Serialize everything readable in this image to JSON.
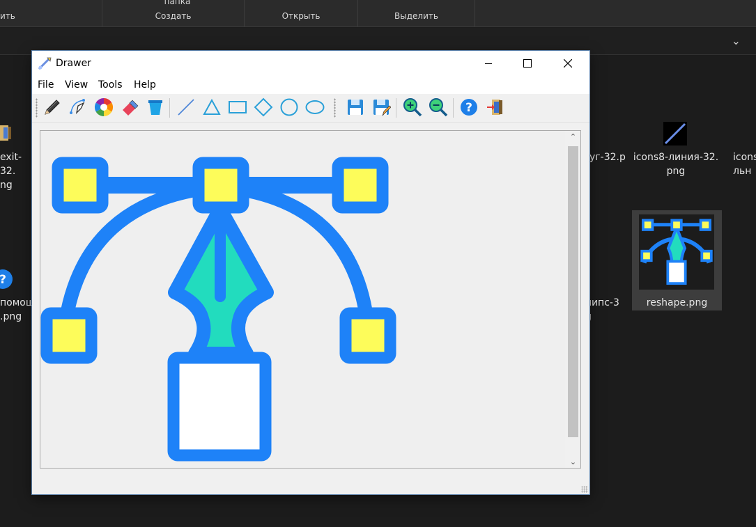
{
  "explorer": {
    "ribbon_groups": [
      {
        "label": "ить"
      },
      {
        "label": "Создать"
      },
      {
        "label": "Открыть"
      },
      {
        "label": "Выделить"
      }
    ],
    "ribbon_top_text": "папка",
    "files": [
      {
        "name_line1": "exit-32.",
        "name_line2": "ng"
      },
      {
        "name_line1": "уг-32.р",
        "name_line2": ""
      },
      {
        "name_line1": "icons8-линия-32.",
        "name_line2": "png"
      },
      {
        "name_line1": "icons",
        "name_line2": "льн"
      },
      {
        "name_line1": "помощ",
        "name_line2": ".png"
      },
      {
        "name_line1": "липс-3",
        "name_line2": "g"
      },
      {
        "name_line1": "reshape.png",
        "name_line2": ""
      }
    ]
  },
  "window": {
    "title": "Drawer",
    "menu": [
      "File",
      "View",
      "Tools",
      "Help"
    ],
    "toolbar_icons": [
      "pencil-icon",
      "bezier-pen-icon",
      "color-wheel-icon",
      "eraser-icon",
      "bucket-icon",
      "line-icon",
      "triangle-icon",
      "rectangle-icon",
      "diamond-icon",
      "circle-icon",
      "ellipse-icon",
      "save-icon",
      "save-as-icon",
      "zoom-in-icon",
      "zoom-out-icon",
      "help-icon",
      "exit-icon"
    ]
  },
  "colors": {
    "accent_blue": "#1e82f8",
    "nib_teal": "#22dcbe",
    "handle_yellow": "#fdfc5a"
  }
}
